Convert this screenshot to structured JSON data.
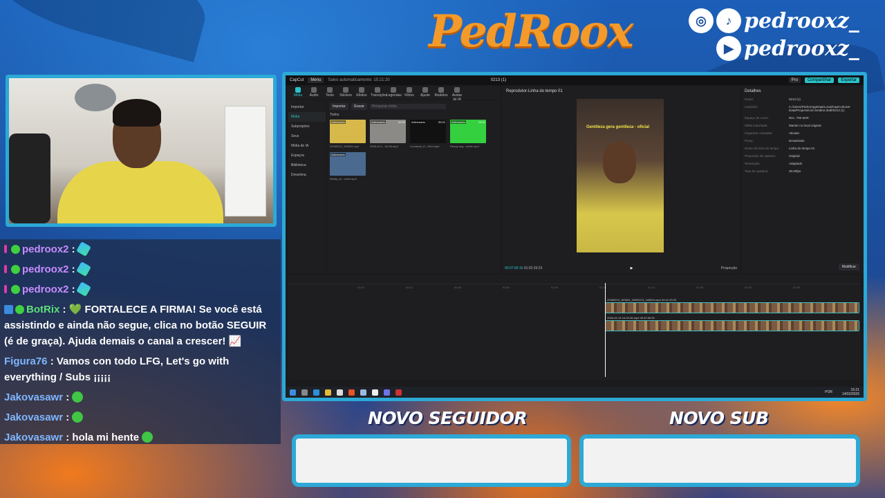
{
  "brand": {
    "logo_text": "PedRoox"
  },
  "social": {
    "instagram_icon": "instagram-icon",
    "tiktok_icon": "tiktok-icon",
    "youtube_icon": "youtube-icon",
    "handle_1": "pedrooxz_",
    "handle_2": "pedrooxz_"
  },
  "chat": {
    "messages": [
      {
        "user": "pedroox2",
        "color": "#c98cff",
        "text": " : ",
        "emote": "feather"
      },
      {
        "user": "pedroox2",
        "color": "#c98cff",
        "text": " : ",
        "emote": "feather"
      },
      {
        "user": "pedroox2",
        "color": "#c98cff",
        "text": " : ",
        "emote": "feather"
      },
      {
        "user": "BotRix",
        "color": "#5be07a",
        "text": " : 💚 FORTALECE A FIRMA! Se você está assistindo e ainda não segue, clica no botão SEGUIR (é de graça). Ajuda demais o canal a crescer! 📈"
      },
      {
        "user": "Figura76",
        "color": "#7fb6ff",
        "text": " : Vamos con todo LFG, Let's go with everything / Subs ¡¡¡¡¡"
      },
      {
        "user": "Jakovasawr",
        "color": "#7fb6ff",
        "text": " : ",
        "emote": "green"
      },
      {
        "user": "Jakovasawr",
        "color": "#7fb6ff",
        "text": " : ",
        "emote": "green"
      },
      {
        "user": "Jakovasawr",
        "color": "#7fb6ff",
        "text": " : hola mi hente ",
        "emote": "green"
      }
    ]
  },
  "capcut": {
    "app_name": "CapCut",
    "menu_label": "Menu",
    "autosave": "Salvo automaticamente: 15:21:20",
    "project_title": "0213 (1)",
    "pro_label": "Pro",
    "share_label": "Compartilhar",
    "export_label": "Exportar",
    "tools": [
      "Mídia",
      "Áudio",
      "Texto",
      "Stickers",
      "Efeitos",
      "Transições",
      "Legendas",
      "Filtros",
      "Ajuste",
      "Modelos",
      "Avatar de IA"
    ],
    "left_nav": [
      "Importar",
      "Mídia",
      "Subprojetos",
      "Seus",
      "Mídia de IA",
      "Espaços",
      "Biblioteca",
      "Dreamina"
    ],
    "import_btn": "Importar",
    "record_btn": "Gravar",
    "search_placeholder": "Pesquisar mídia",
    "all_label": "Todos",
    "thumbs": [
      {
        "tag": "Adicionado",
        "dur": "",
        "cap": "20260213_160624.mp4",
        "color": "#d6b94a"
      },
      {
        "tag": "Adicionado",
        "dur": "02:25",
        "cap": "2026-02-1...00-36.mp4",
        "color": "#8b8a86"
      },
      {
        "tag": "Adicionado",
        "dur": "00:21",
        "cap": "Leonardo_D...Hind.mp4",
        "color": "#111111"
      },
      {
        "tag": "Adicionado",
        "dur": "00:11",
        "cap": "Ready ang...ciricle.mp4",
        "color": "#35d040"
      },
      {
        "tag": "Adicionado",
        "dur": "",
        "cap": "Really_sh...carta.mp4",
        "color": "#4a6a90"
      }
    ],
    "player_title": "Reprodutor-Linha do tempo 01",
    "video_caption": "Gentileza gera gentileza - oficial",
    "time_current": "00:07:05:16",
    "time_total": "01:02:33:23",
    "ratio_label": "Proporção",
    "details_title": "Detalhes",
    "details": [
      {
        "k": "Nome:",
        "v": "0213 (1)"
      },
      {
        "k": "Caminho:",
        "v": "C:/Users/Pedro/AppData/Local/CapCut/User Data/Projects/com.lveditor.draft/0213 (1)"
      },
      {
        "k": "Espaço de cores:",
        "v": "Rec. 709 SDR"
      },
      {
        "k": "Mídia importada:",
        "v": "Manter no local original"
      },
      {
        "k": "Organizar camadas:",
        "v": "Ativado"
      },
      {
        "k": "Proxy:",
        "v": "Desativado"
      },
      {
        "k": "Nome da linha do tempo:",
        "v": "Linha do tempo 01"
      },
      {
        "k": "Proporção de aspecto:",
        "v": "Original"
      },
      {
        "k": "Resolução:",
        "v": "Adaptado"
      },
      {
        "k": "Taxa de quadros:",
        "v": "30.00fps"
      }
    ],
    "modify_btn": "Modificar",
    "ruler": [
      "00:00",
      "00:42",
      "00:40",
      "00:50",
      "01:00",
      "01:10",
      "01:20",
      "01:30",
      "01:40",
      "01:50"
    ],
    "track_1_label": "20260213_160624_20260213_160624.mp4   00:41:33:23",
    "track_2_label": "2026-02-13 16-00-36.mp4   00:40:36:30",
    "clock_time": "15:21",
    "clock_date": "14/02/2026",
    "lang": "POR"
  },
  "alerts": {
    "follower_title": "NOVO SEGUIDOR",
    "sub_title": "NOVO SUB"
  }
}
